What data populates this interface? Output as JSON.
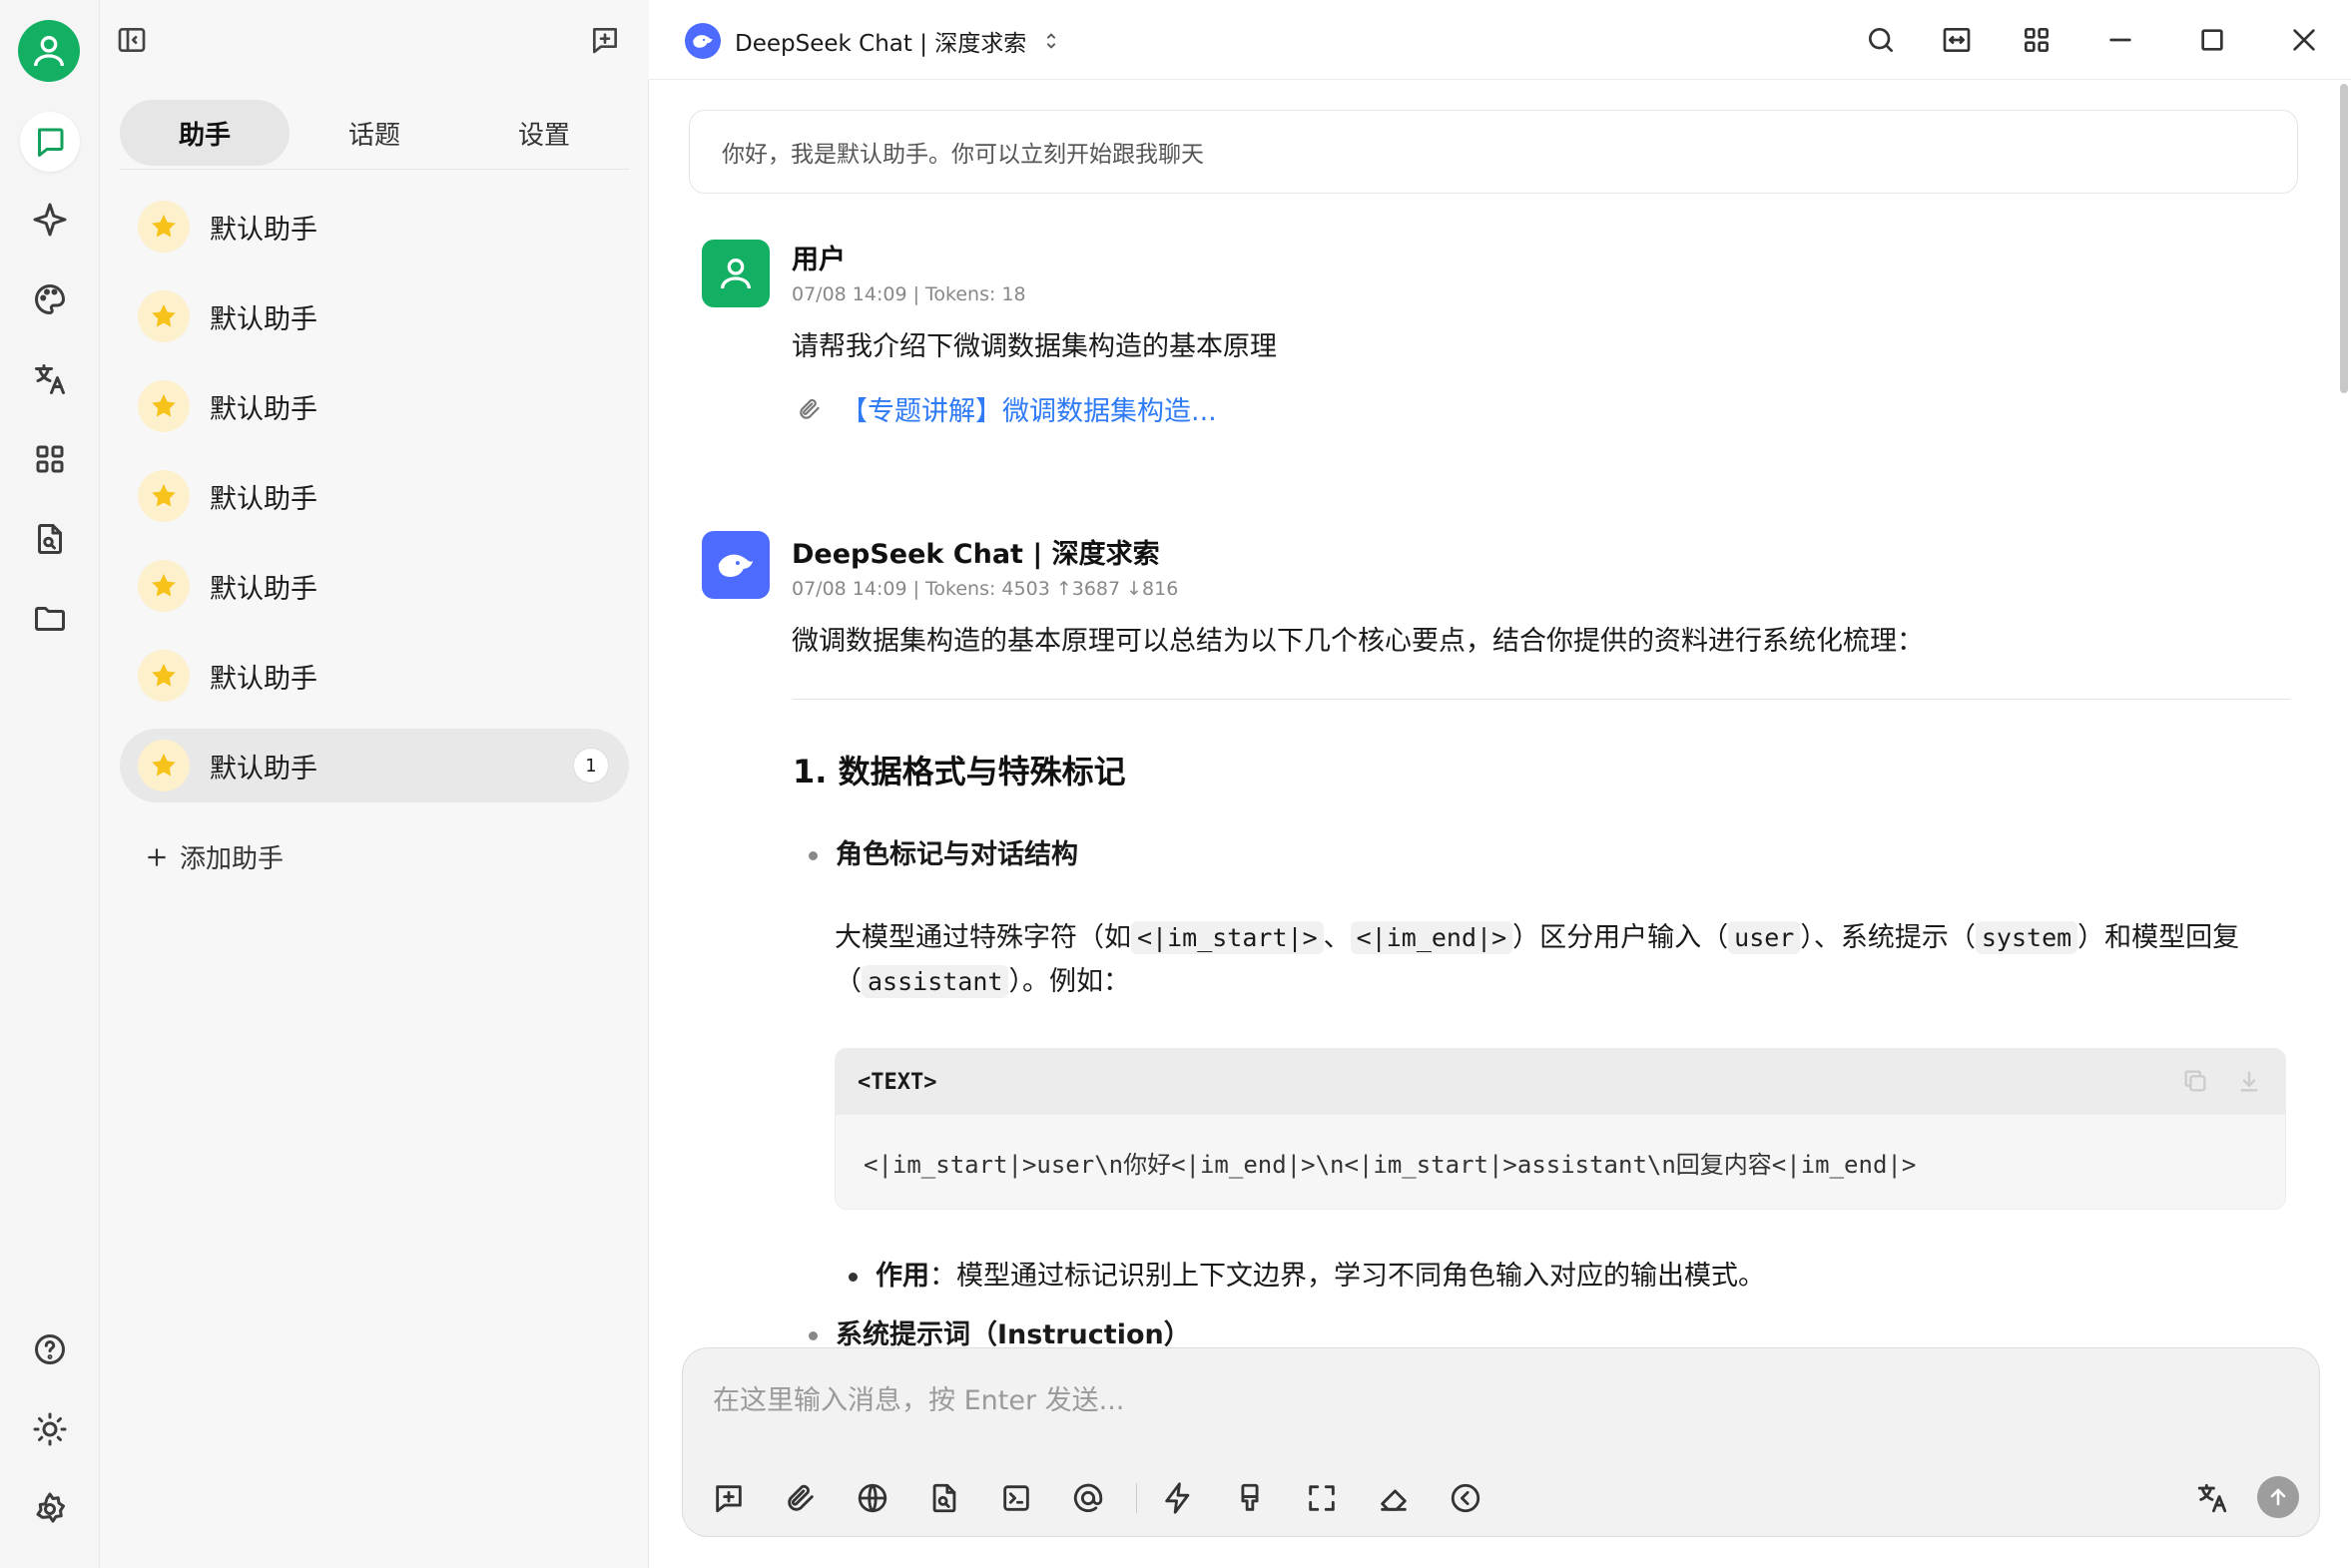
{
  "window": {
    "title": "DeepSeek Chat | 深度求索"
  },
  "sidebar": {
    "tabs": [
      {
        "label": "助手",
        "active": true
      },
      {
        "label": "话题",
        "active": false
      },
      {
        "label": "设置",
        "active": false
      }
    ],
    "assistants": [
      {
        "label": "默认助手"
      },
      {
        "label": "默认助手"
      },
      {
        "label": "默认助手"
      },
      {
        "label": "默认助手"
      },
      {
        "label": "默认助手"
      },
      {
        "label": "默认助手"
      },
      {
        "label": "默认助手",
        "active": true,
        "badge": "1"
      }
    ],
    "add_label": "添加助手"
  },
  "chat": {
    "system_prompt": "你好，我是默认助手。你可以立刻开始跟我聊天",
    "user_msg": {
      "name": "用户",
      "meta": "07/08 14:09  |  Tokens: 18",
      "text": "请帮我介绍下微调数据集构造的基本原理",
      "attachment": "【专题讲解】微调数据集构造..."
    },
    "bot_msg": {
      "name": "DeepSeek Chat | 深度求索",
      "meta": "07/08 14:09  |  Tokens: 4503 ↑3687 ↓816",
      "intro": "微调数据集构造的基本原理可以总结为以下几个核心要点，结合你提供的资料进行系统化梳理：",
      "heading": "1. 数据格式与特殊标记",
      "bullet1": "角色标记与对话结构",
      "para": {
        "t1": "大模型通过特殊字符（如",
        "c1": "<|im_start|>",
        "t2": "、",
        "c2": "<|im_end|>",
        "t3": "）区分用户输入（",
        "c3": "user",
        "t4": "）、系统提示（",
        "c4": "system",
        "t5": "）和模型回复（",
        "c5": "assistant",
        "t6": "）。例如："
      },
      "code_lang": "<TEXT>",
      "code_text": "<|im_start|>user\\n你好<|im_end|>\\n<|im_start|>assistant\\n回复内容<|im_end|>",
      "sub_bullet_bold": "作用",
      "sub_bullet_text": "：模型通过标记识别上下文边界，学习不同角色输入对应的输出模式。",
      "bullet2": "系统提示词（Instruction）"
    }
  },
  "composer": {
    "placeholder": "在这里输入消息，按 Enter 发送..."
  },
  "colors": {
    "accent_green": "#13b064",
    "deepseek_blue": "#4d6bfe",
    "link_blue": "#2f7bf5"
  }
}
